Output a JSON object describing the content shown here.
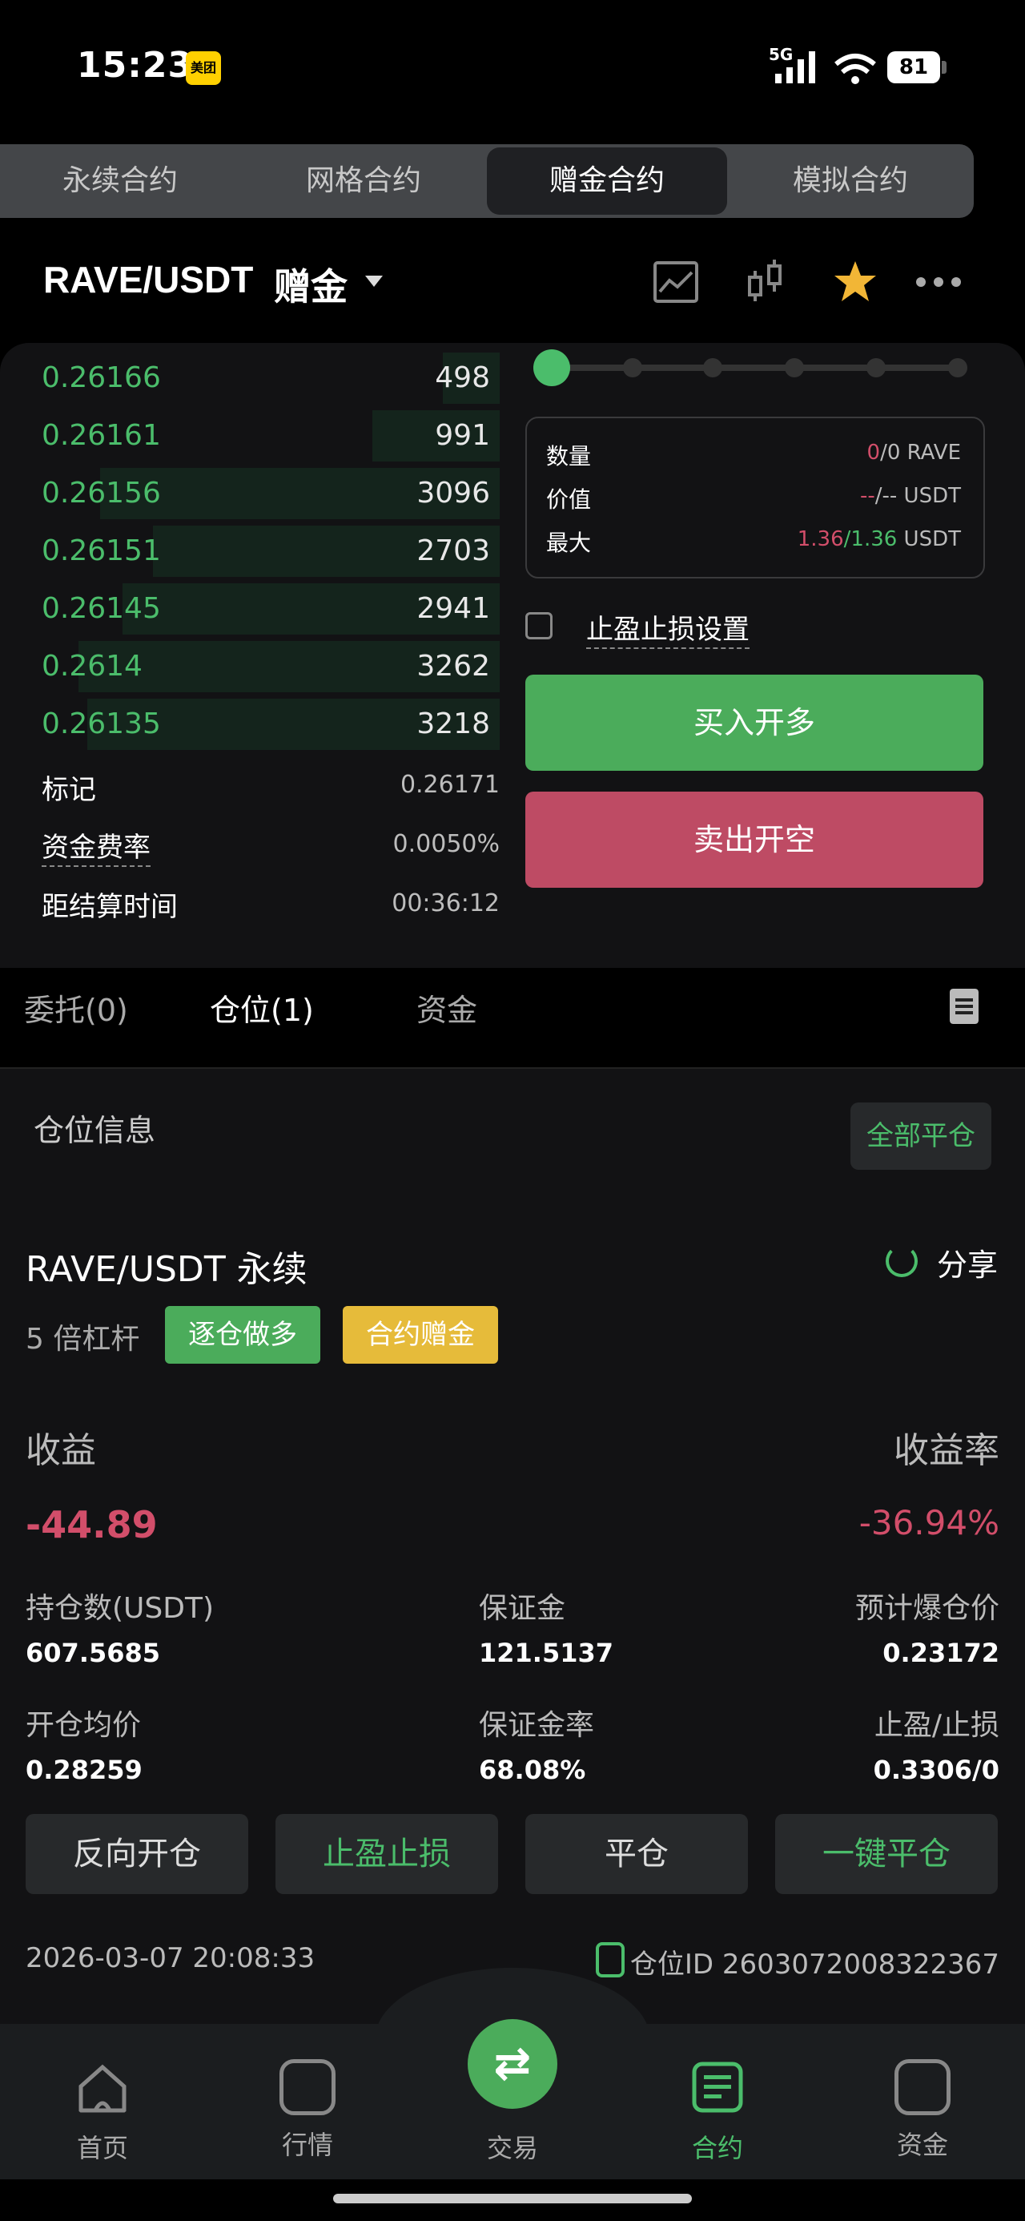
{
  "status_bar": {
    "time": "15:23",
    "app_badge": "美团",
    "network": "5G",
    "battery": "81"
  },
  "contract_tabs": [
    {
      "label": "永续合约",
      "active": false
    },
    {
      "label": "网格合约",
      "active": false
    },
    {
      "label": "赠金合约",
      "active": true
    },
    {
      "label": "模拟合约",
      "active": false
    }
  ],
  "header": {
    "pair": "RAVE/USDT",
    "mode": "赠金",
    "icons": [
      "chart-line-icon",
      "candlestick-icon",
      "star-icon",
      "more-icon"
    ]
  },
  "order_book": [
    {
      "price": "0.26166",
      "qty": "498",
      "depth": 0.13
    },
    {
      "price": "0.26161",
      "qty": "991",
      "depth": 0.29
    },
    {
      "price": "0.26156",
      "qty": "3096",
      "depth": 0.91
    },
    {
      "price": "0.26151",
      "qty": "2703",
      "depth": 0.79
    },
    {
      "price": "0.26145",
      "qty": "2941",
      "depth": 0.86
    },
    {
      "price": "0.2614",
      "qty": "3262",
      "depth": 0.96
    },
    {
      "price": "0.26135",
      "qty": "3218",
      "depth": 0.94
    }
  ],
  "stats": {
    "mark_label": "标记",
    "mark_value": "0.26171",
    "funding_label": "资金费率",
    "funding_value": "0.0050%",
    "settle_label": "距结算时间",
    "settle_value": "00:36:12"
  },
  "order_form": {
    "slider_percent": 0,
    "qty_label": "数量",
    "qty_value_a": "0",
    "qty_value_b": "/0 RAVE",
    "value_label": "价值",
    "value_value_a": "--",
    "value_value_b": "/-- USDT",
    "max_label": "最大",
    "max_value_a": "1.36",
    "max_value_b": "/1.36",
    "max_unit": " USDT",
    "tpsl_label": "止盈止损设置",
    "buy_label": "买入开多",
    "sell_label": "卖出开空"
  },
  "position_tabs": [
    {
      "label": "委托(0)",
      "active": false
    },
    {
      "label": "仓位(1)",
      "active": true
    },
    {
      "label": "资金",
      "active": false
    }
  ],
  "position": {
    "section_title": "仓位信息",
    "close_all": "全部平仓",
    "title": "RAVE/USDT 永续",
    "share": "分享",
    "leverage": "5 倍杠杆",
    "badge_mode": "逐仓做多",
    "badge_bonus": "合约赠金",
    "pnl_label": "收益",
    "pnl_rate_label": "收益率",
    "pnl_value": "-44.89",
    "pnl_rate_value": "-36.94%",
    "size_label": "持仓数(USDT)",
    "size_value": "607.5685",
    "margin_label": "保证金",
    "margin_value": "121.5137",
    "liq_label": "预计爆仓价",
    "liq_value": "0.23172",
    "entry_label": "开仓均价",
    "entry_value": "0.28259",
    "margin_rate_label": "保证金率",
    "margin_rate_value": "68.08%",
    "tpsl_label": "止盈/止损",
    "tpsl_value": "0.3306/0",
    "actions": [
      "反向开仓",
      "止盈止损",
      "平仓",
      "一键平仓"
    ],
    "timestamp": "2026-03-07 20:08:33",
    "position_id": "仓位ID 2603072008322367"
  },
  "bottom_nav": [
    {
      "label": "首页",
      "icon": "home-icon",
      "active": false
    },
    {
      "label": "行情",
      "icon": "market-icon",
      "active": false
    },
    {
      "label": "交易",
      "icon": "swap-icon",
      "active": false
    },
    {
      "label": "合约",
      "icon": "contract-icon",
      "active": true
    },
    {
      "label": "资金",
      "icon": "wallet-icon",
      "active": false
    }
  ],
  "colors": {
    "green": "#4bbd6b",
    "red": "#d24e6a",
    "buy_button": "#4bac5b",
    "sell_button": "#be4b64",
    "yellow": "#e6bb3a"
  }
}
